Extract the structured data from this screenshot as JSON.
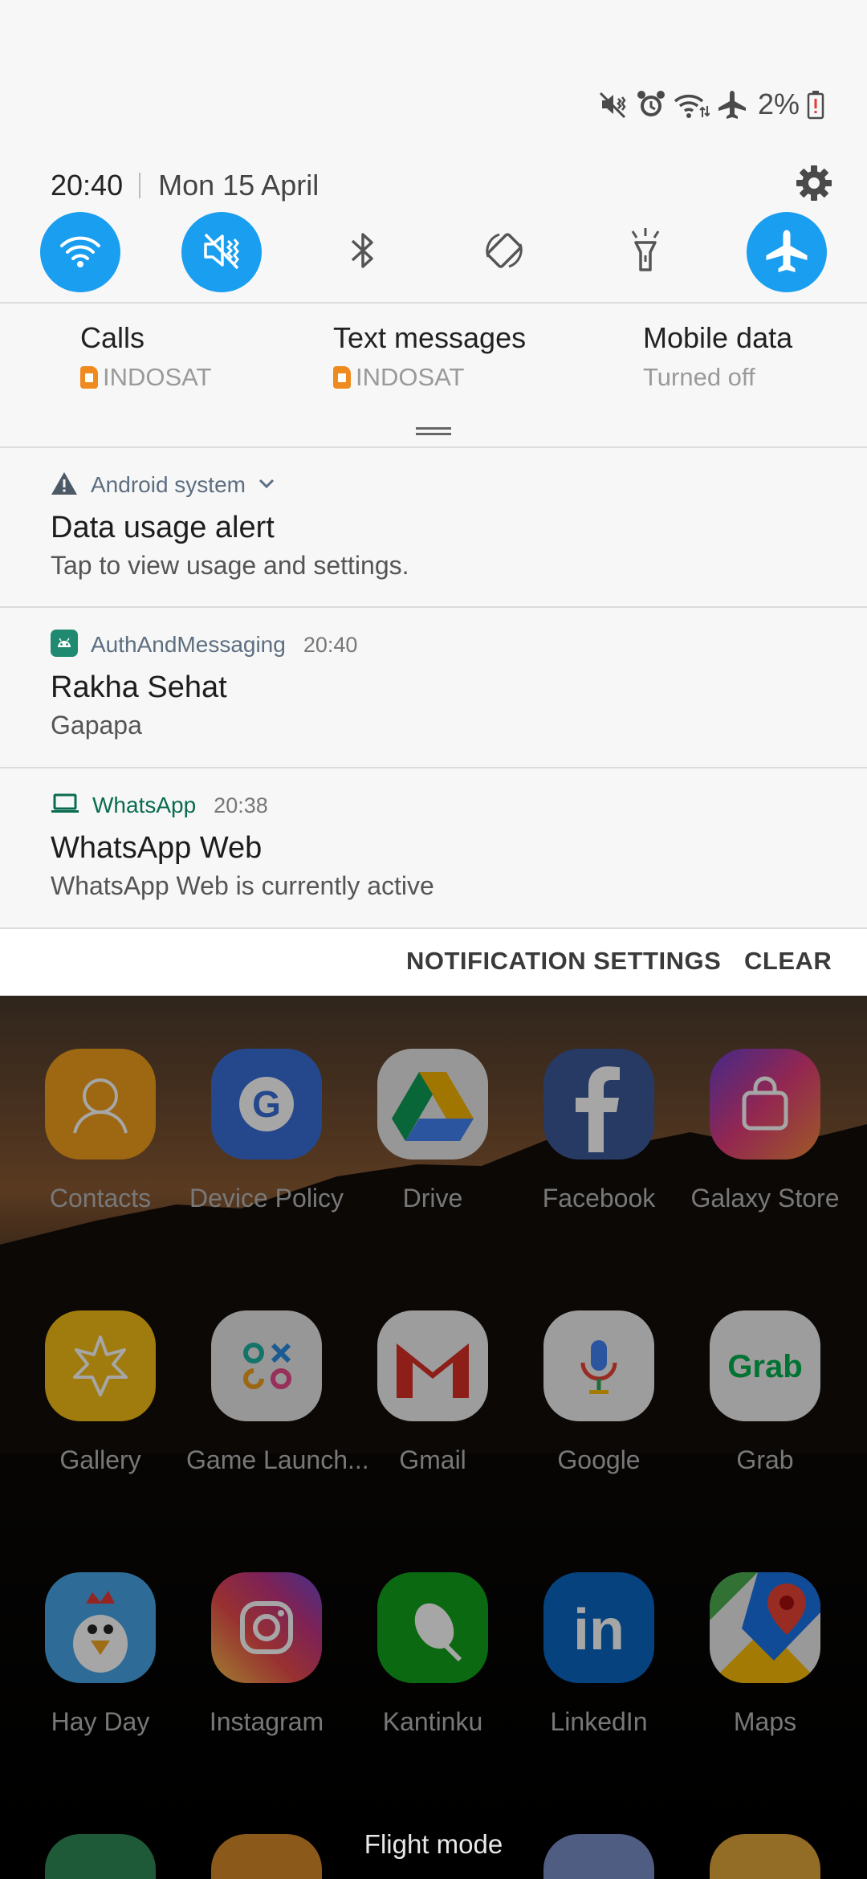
{
  "status_bar": {
    "icons": [
      "mute-vibrate-icon",
      "alarm-icon",
      "wifi-data-icon",
      "airplane-icon"
    ],
    "battery_percent": "2%"
  },
  "header": {
    "time": "20:40",
    "date": "Mon 15 April"
  },
  "quick_settings": [
    {
      "name": "wifi",
      "icon": "wifi-icon",
      "active": true
    },
    {
      "name": "sound",
      "icon": "mute-icon",
      "active": true
    },
    {
      "name": "bluetooth",
      "icon": "bluetooth-icon",
      "active": false
    },
    {
      "name": "auto-rotate",
      "icon": "rotate-icon",
      "active": false
    },
    {
      "name": "flashlight",
      "icon": "flashlight-icon",
      "active": false
    },
    {
      "name": "flight-mode",
      "icon": "airplane-icon",
      "active": true
    }
  ],
  "sim_cards": {
    "calls": {
      "title": "Calls",
      "value": "INDOSAT"
    },
    "texts": {
      "title": "Text messages",
      "value": "INDOSAT"
    },
    "data": {
      "title": "Mobile data",
      "value": "Turned off"
    }
  },
  "notifications": [
    {
      "app": "Android system",
      "time": "",
      "title": "Data usage alert",
      "body": "Tap to view usage and settings."
    },
    {
      "app": "AuthAndMessaging",
      "time": "20:40",
      "title": "Rakha Sehat",
      "body": "Gapapa"
    },
    {
      "app": "WhatsApp",
      "time": "20:38",
      "title": "WhatsApp Web",
      "body": "WhatsApp Web is currently active"
    }
  ],
  "actions": {
    "settings_label": "NOTIFICATION SETTINGS",
    "clear_label": "CLEAR"
  },
  "apps": [
    {
      "label": "Contacts",
      "color": "#f3a01c"
    },
    {
      "label": "Device Policy",
      "color": "#3a6fd8"
    },
    {
      "label": "Drive",
      "color": "#e9e9e9"
    },
    {
      "label": "Facebook",
      "color": "#3b5a9a"
    },
    {
      "label": "Galaxy Store",
      "color": "#c2378c"
    },
    {
      "label": "Gallery",
      "color": "#f6bd16"
    },
    {
      "label": "Game Launch...",
      "color": "#e9e9e9"
    },
    {
      "label": "Gmail",
      "color": "#f2f2f2"
    },
    {
      "label": "Google",
      "color": "#f2f2f2"
    },
    {
      "label": "Grab",
      "color": "#f2f2f2"
    },
    {
      "label": "Hay Day",
      "color": "#47a7e8"
    },
    {
      "label": "Instagram",
      "color": "#c13584"
    },
    {
      "label": "Kantinku",
      "color": "#12a21b"
    },
    {
      "label": "LinkedIn",
      "color": "#0a66c2"
    },
    {
      "label": "Maps",
      "color": "#ececec"
    }
  ],
  "toast": "Flight mode"
}
